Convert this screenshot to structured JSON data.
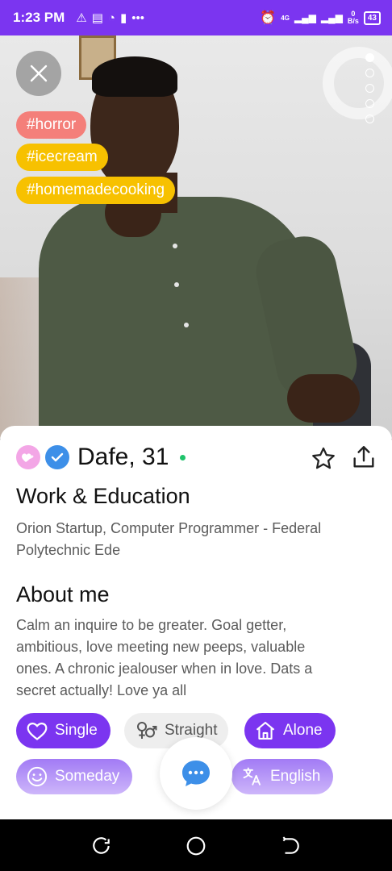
{
  "status_bar": {
    "time": "1:23 PM",
    "network": "4G",
    "speed_value": "0",
    "speed_unit": "B/s",
    "battery": "43"
  },
  "profile": {
    "tags": [
      "#horror",
      "#icecream",
      "#homemadecooking"
    ],
    "tag_colors": [
      "#f47f7a",
      "#f7c100",
      "#f7c100"
    ],
    "photo_count": 5,
    "active_photo_index": 0,
    "name_age": "Dafe, 31",
    "online": true,
    "work_education": {
      "heading": "Work & Education",
      "line1": "Orion Startup, Computer Programmer - Federal",
      "line2": "Polytechnic Ede"
    },
    "about": {
      "heading": "About me",
      "line1": "Calm an inquire to be greater. Goal getter,",
      "line2": "ambitious, love meeting new peeps, valuable",
      "line3": "ones. A chronic jealouser when in love. Dats a",
      "line4": "secret actually! Love ya all"
    },
    "attributes": {
      "relationship": "Single",
      "orientation": "Straight",
      "living": "Alone",
      "kids": "Someday",
      "language": "English"
    }
  },
  "colors": {
    "accent": "#7b35f0",
    "online": "#1fc36b",
    "verified": "#3d8fe8",
    "chat": "#3d8fe8"
  },
  "icons": [
    "close-icon",
    "star-icon",
    "share-icon",
    "heart-icon",
    "gender-icon",
    "home-icon",
    "smiley-icon",
    "translate-icon",
    "chat-icon"
  ]
}
